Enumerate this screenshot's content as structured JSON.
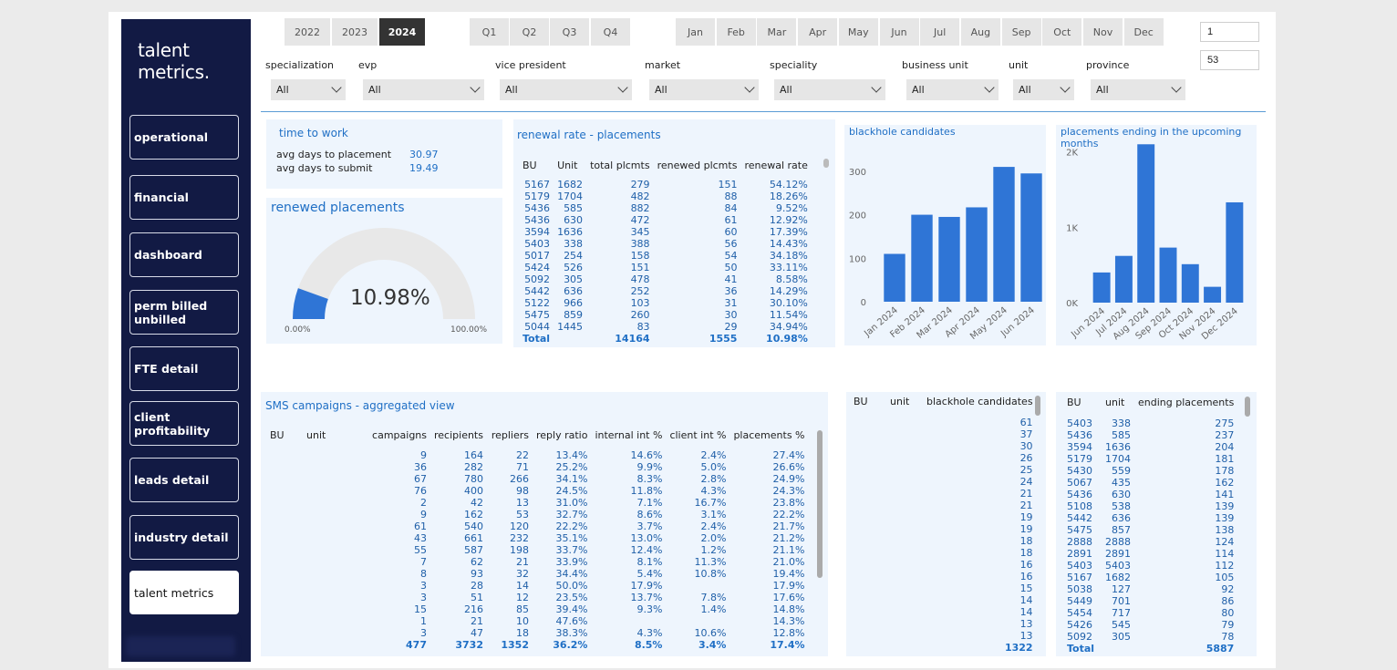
{
  "sidebar": {
    "brand": "talent\nmetrics.",
    "items": [
      "operational",
      "financial",
      "dashboard",
      "perm billed unbilled",
      "FTE detail",
      "client profitability",
      "leads detail",
      "industry detail",
      "talent metrics"
    ],
    "active": "talent metrics"
  },
  "years": [
    "2022",
    "2023",
    "2024"
  ],
  "selected_year": "2024",
  "quarters": [
    "Q1",
    "Q2",
    "Q3",
    "Q4"
  ],
  "months": [
    "Jan",
    "Feb",
    "Mar",
    "Apr",
    "May",
    "Jun",
    "Jul",
    "Aug",
    "Sep",
    "Oct",
    "Nov",
    "Dec"
  ],
  "range": {
    "from": "1",
    "to": "53"
  },
  "filters": [
    {
      "label": "specialization",
      "value": "All"
    },
    {
      "label": "evp",
      "value": "All"
    },
    {
      "label": "vice president",
      "value": "All"
    },
    {
      "label": "market",
      "value": "All"
    },
    {
      "label": "speciality",
      "value": "All"
    },
    {
      "label": "business unit",
      "value": "All"
    },
    {
      "label": "unit",
      "value": "All"
    },
    {
      "label": "province",
      "value": "All"
    }
  ],
  "time_to_work": {
    "title": "time to work",
    "rows": [
      {
        "label": "avg days to placement",
        "value": "30.97"
      },
      {
        "label": "avg days to submit",
        "value": "19.49"
      }
    ]
  },
  "renewed": {
    "title": "renewed placements",
    "value": "10.98%",
    "fraction": 0.1098,
    "min": "0.00%",
    "max": "100.00%"
  },
  "renewal": {
    "title": "renewal rate - placements",
    "headers": [
      "BU",
      "Unit",
      "total plcmts",
      "renewed plcmts",
      "renewal rate"
    ],
    "rows": [
      [
        "5167",
        "1682",
        "279",
        "151",
        "54.12%"
      ],
      [
        "5179",
        "1704",
        "482",
        "88",
        "18.26%"
      ],
      [
        "5436",
        "585",
        "882",
        "84",
        "9.52%"
      ],
      [
        "5436",
        "630",
        "472",
        "61",
        "12.92%"
      ],
      [
        "3594",
        "1636",
        "345",
        "60",
        "17.39%"
      ],
      [
        "5403",
        "338",
        "388",
        "56",
        "14.43%"
      ],
      [
        "5017",
        "254",
        "158",
        "54",
        "34.18%"
      ],
      [
        "5424",
        "526",
        "151",
        "50",
        "33.11%"
      ],
      [
        "5092",
        "305",
        "478",
        "41",
        "8.58%"
      ],
      [
        "5442",
        "636",
        "252",
        "36",
        "14.29%"
      ],
      [
        "5122",
        "966",
        "103",
        "31",
        "30.10%"
      ],
      [
        "5475",
        "859",
        "260",
        "30",
        "11.54%"
      ],
      [
        "5044",
        "1445",
        "83",
        "29",
        "34.94%"
      ]
    ],
    "total": [
      "Total",
      "",
      "14164",
      "1555",
      "10.98%"
    ]
  },
  "chart_data": [
    {
      "type": "bar",
      "title": "blackhole candidates",
      "categories": [
        "Jan 2024",
        "Feb 2024",
        "Mar 2024",
        "Apr 2024",
        "May 2024",
        "Jun 2024"
      ],
      "values": [
        110,
        200,
        195,
        217,
        310,
        295
      ],
      "yticks": [
        "0",
        "100",
        "200",
        "300"
      ],
      "ylim": [
        0,
        350
      ],
      "color": "#2f75d6"
    },
    {
      "type": "bar",
      "title": "placements ending in the upcoming months",
      "categories": [
        "Jun 2024",
        "Jul 2024",
        "Aug 2024",
        "Sep 2024",
        "Oct 2024",
        "Nov 2024",
        "Dec 2024"
      ],
      "values": [
        400,
        620,
        2100,
        730,
        510,
        210,
        1330
      ],
      "yticks": [
        "0K",
        "1K",
        "2K"
      ],
      "ylim": [
        0,
        2200
      ],
      "color": "#2f75d6"
    }
  ],
  "sms": {
    "title": "SMS campaigns - aggregated view",
    "headers": [
      "BU",
      "unit",
      "campaigns",
      "recipients",
      "repliers",
      "reply ratio",
      "internal int %",
      "client int %",
      "placements %"
    ],
    "rows": [
      [
        "9",
        "164",
        "22",
        "13.4%",
        "14.6%",
        "2.4%",
        "27.4%"
      ],
      [
        "36",
        "282",
        "71",
        "25.2%",
        "9.9%",
        "5.0%",
        "26.6%"
      ],
      [
        "67",
        "780",
        "266",
        "34.1%",
        "8.3%",
        "2.8%",
        "24.9%"
      ],
      [
        "76",
        "400",
        "98",
        "24.5%",
        "11.8%",
        "4.3%",
        "24.3%"
      ],
      [
        "2",
        "42",
        "13",
        "31.0%",
        "7.1%",
        "16.7%",
        "23.8%"
      ],
      [
        "9",
        "162",
        "53",
        "32.7%",
        "8.6%",
        "3.1%",
        "22.2%"
      ],
      [
        "61",
        "540",
        "120",
        "22.2%",
        "3.7%",
        "2.4%",
        "21.7%"
      ],
      [
        "43",
        "661",
        "232",
        "35.1%",
        "13.0%",
        "2.0%",
        "21.2%"
      ],
      [
        "55",
        "587",
        "198",
        "33.7%",
        "12.4%",
        "1.2%",
        "21.1%"
      ],
      [
        "7",
        "62",
        "21",
        "33.9%",
        "8.1%",
        "11.3%",
        "21.0%"
      ],
      [
        "8",
        "93",
        "32",
        "34.4%",
        "5.4%",
        "10.8%",
        "19.4%"
      ],
      [
        "3",
        "28",
        "14",
        "50.0%",
        "17.9%",
        "",
        "17.9%"
      ],
      [
        "3",
        "51",
        "12",
        "23.5%",
        "13.7%",
        "7.8%",
        "17.6%"
      ],
      [
        "15",
        "216",
        "85",
        "39.4%",
        "9.3%",
        "1.4%",
        "14.8%"
      ],
      [
        "1",
        "21",
        "10",
        "47.6%",
        "",
        "",
        "14.3%"
      ],
      [
        "3",
        "47",
        "18",
        "38.3%",
        "4.3%",
        "10.6%",
        "12.8%"
      ]
    ],
    "total": [
      "477",
      "3732",
      "1352",
      "36.2%",
      "8.5%",
      "3.4%",
      "17.4%"
    ]
  },
  "blackhole_table": {
    "headers": [
      "BU",
      "unit",
      "blackhole candidates"
    ],
    "values": [
      "61",
      "37",
      "30",
      "26",
      "25",
      "24",
      "21",
      "21",
      "19",
      "19",
      "18",
      "18",
      "16",
      "16",
      "15",
      "14",
      "14",
      "13",
      "13"
    ],
    "total": "1322"
  },
  "ending_table": {
    "headers": [
      "BU",
      "unit",
      "ending placements"
    ],
    "rows": [
      [
        "5403",
        "338",
        "275"
      ],
      [
        "5436",
        "585",
        "237"
      ],
      [
        "3594",
        "1636",
        "204"
      ],
      [
        "5179",
        "1704",
        "181"
      ],
      [
        "5430",
        "559",
        "178"
      ],
      [
        "5067",
        "435",
        "162"
      ],
      [
        "5436",
        "630",
        "141"
      ],
      [
        "5108",
        "538",
        "139"
      ],
      [
        "5442",
        "636",
        "139"
      ],
      [
        "5475",
        "857",
        "138"
      ],
      [
        "2888",
        "2888",
        "124"
      ],
      [
        "2891",
        "2891",
        "114"
      ],
      [
        "5403",
        "5403",
        "112"
      ],
      [
        "5167",
        "1682",
        "105"
      ],
      [
        "5038",
        "127",
        "92"
      ],
      [
        "5449",
        "701",
        "86"
      ],
      [
        "5454",
        "717",
        "80"
      ],
      [
        "5426",
        "545",
        "79"
      ],
      [
        "5092",
        "305",
        "78"
      ]
    ],
    "total": [
      "Total",
      "",
      "5887"
    ]
  }
}
